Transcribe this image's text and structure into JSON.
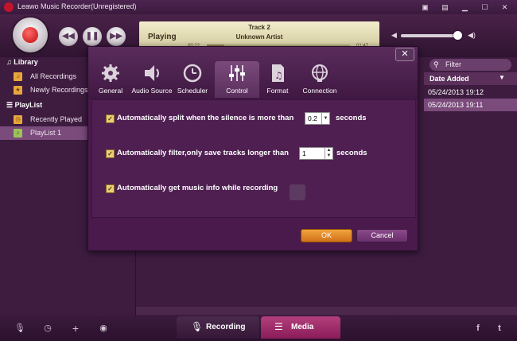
{
  "window": {
    "title": "Leawo Music Recorder(Unregistered)"
  },
  "player": {
    "state": "Playing",
    "track": "Track 2",
    "artist": "Unknown Artist",
    "time_elapsed": "00:22",
    "time_total": "01:47",
    "progress_fraction": 0.12,
    "volume_fraction": 0.93
  },
  "sidebar": {
    "library_title": "Library",
    "library_items": [
      {
        "label": "All Recordings",
        "icon": "music-folder-icon"
      },
      {
        "label": "Newly Recordings",
        "icon": "star-folder-icon"
      }
    ],
    "playlist_title": "PlayList",
    "playlist_items": [
      {
        "label": "Recently Played",
        "icon": "recent-folder-icon"
      },
      {
        "label": "PlayList 1",
        "icon": "playlist-folder-icon",
        "selected": true
      }
    ]
  },
  "list": {
    "filter_placeholder": "Filter",
    "column_date": "Date Added",
    "rows": [
      {
        "date": "05/24/2013 19:12",
        "selected": false
      },
      {
        "date": "05/24/2013 19:11",
        "selected": true
      }
    ]
  },
  "dialog": {
    "tabs": [
      {
        "label": "General",
        "icon": "gear-icon"
      },
      {
        "label": "Audio Source",
        "icon": "speaker-icon"
      },
      {
        "label": "Scheduler",
        "icon": "clock-icon"
      },
      {
        "label": "Control",
        "icon": "sliders-icon",
        "selected": true
      },
      {
        "label": "Format",
        "icon": "music-file-icon"
      },
      {
        "label": "Connection",
        "icon": "globe-icon"
      }
    ],
    "options": {
      "split_label": "Automatically split when the silence is more than",
      "split_value": "0.2",
      "split_unit": "seconds",
      "filter_label": "Automatically filter,only save tracks longer than",
      "filter_value": "1",
      "filter_unit": "seconds",
      "info_label": "Automatically get music info while recording"
    },
    "ok_label": "OK",
    "cancel_label": "Cancel"
  },
  "bottom": {
    "recording_label": "Recording",
    "media_label": "Media"
  },
  "colors": {
    "background": "#3d1c3f",
    "accent_orange": "#e0891f",
    "media_tab": "#a0306c",
    "selected_row": "#7a4b7b"
  }
}
